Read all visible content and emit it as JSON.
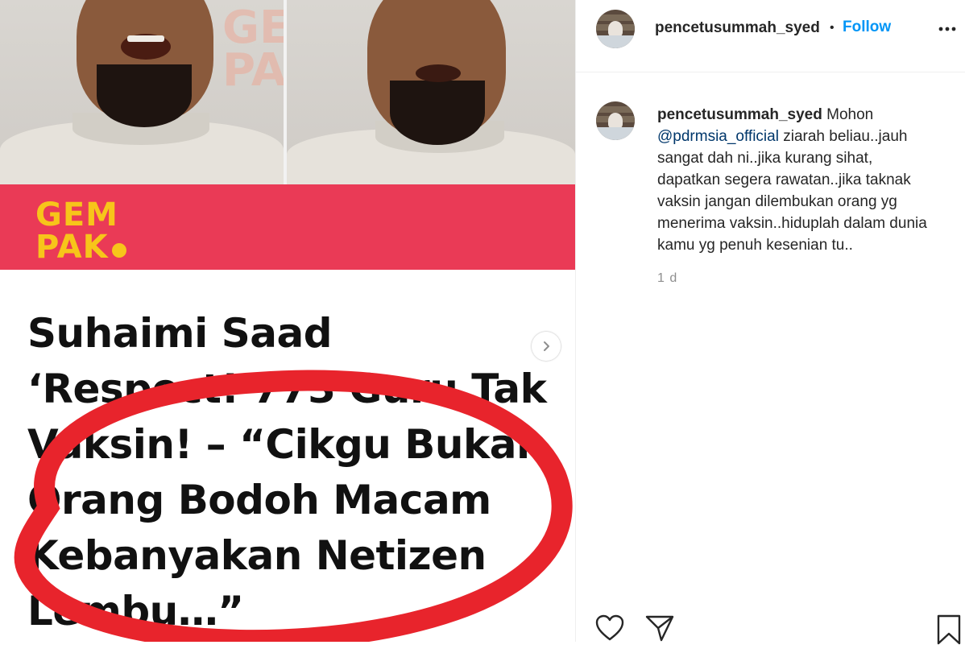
{
  "post": {
    "watermark_top": "GEM",
    "watermark_bottom": "PAK",
    "brand_top": "GEM",
    "brand_bottom": "PAK",
    "headline_lines": [
      "Suhaimi Saad",
      "‘Respect! 773 Guru Tak",
      "Vaksin! – “Cikgu Bukan",
      "Orang Bodoh Macam",
      "Kebanyakan Netizen",
      "Lembu…”"
    ],
    "next_icon": "chevron-right-icon",
    "colors": {
      "brand_bar": "#ea3a56",
      "brand_logo": "#f7c51a",
      "circle": "#e8242c"
    }
  },
  "header": {
    "username": "pencetusummah_syed",
    "separator": "•",
    "follow_label": "Follow",
    "more_icon": "more-horizontal-icon"
  },
  "comment": {
    "username": "pencetusummah_syed",
    "text_before": "Mohon",
    "mention": "@pdrmsia_official",
    "text_after": "ziarah beliau..jauh sangat dah ni..jika kurang sihat, dapatkan segera rawatan..jika taknak vaksin jangan dilembukan orang yg menerima vaksin..hiduplah dalam dunia kamu yg penuh kesenian tu..",
    "time": "1 d"
  },
  "actions": {
    "like_icon": "heart-icon",
    "share_icon": "paper-plane-icon",
    "save_icon": "bookmark-icon"
  },
  "colors": {
    "link": "#00376b",
    "follow": "#0095f6",
    "muted": "#8e8e8e"
  }
}
